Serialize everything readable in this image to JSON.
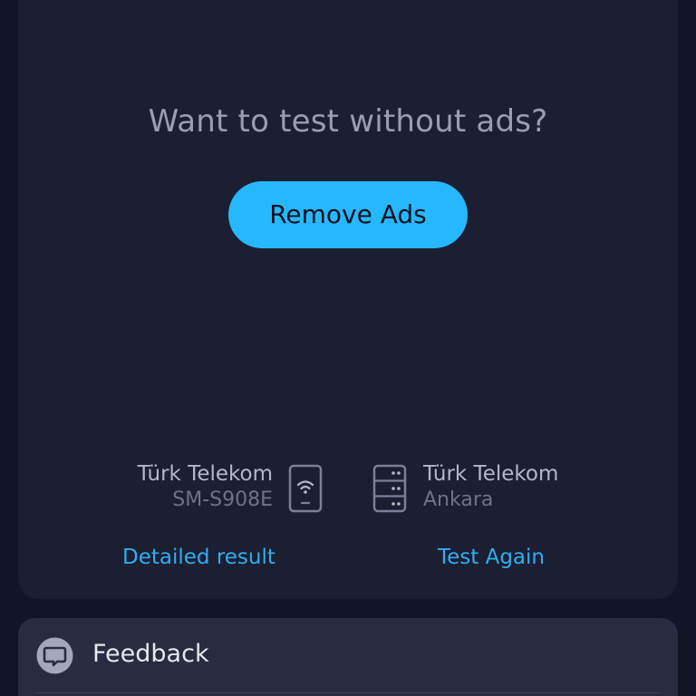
{
  "ad_section": {
    "prompt": "Want to test without ads?",
    "remove_ads_label": "Remove Ads"
  },
  "client": {
    "isp": "Türk Telekom",
    "device": "SM-S908E",
    "icon": "phone-wifi-icon"
  },
  "server": {
    "isp": "Türk Telekom",
    "location": "Ankara",
    "icon": "server-icon"
  },
  "links": {
    "detailed_result": "Detailed result",
    "test_again": "Test Again"
  },
  "feedback": {
    "label": "Feedback",
    "icon": "chat-bubble-icon"
  },
  "colors": {
    "accent": "#26b8ff",
    "link": "#2eaef0",
    "card": "#1c1e31",
    "background": "#121526"
  }
}
